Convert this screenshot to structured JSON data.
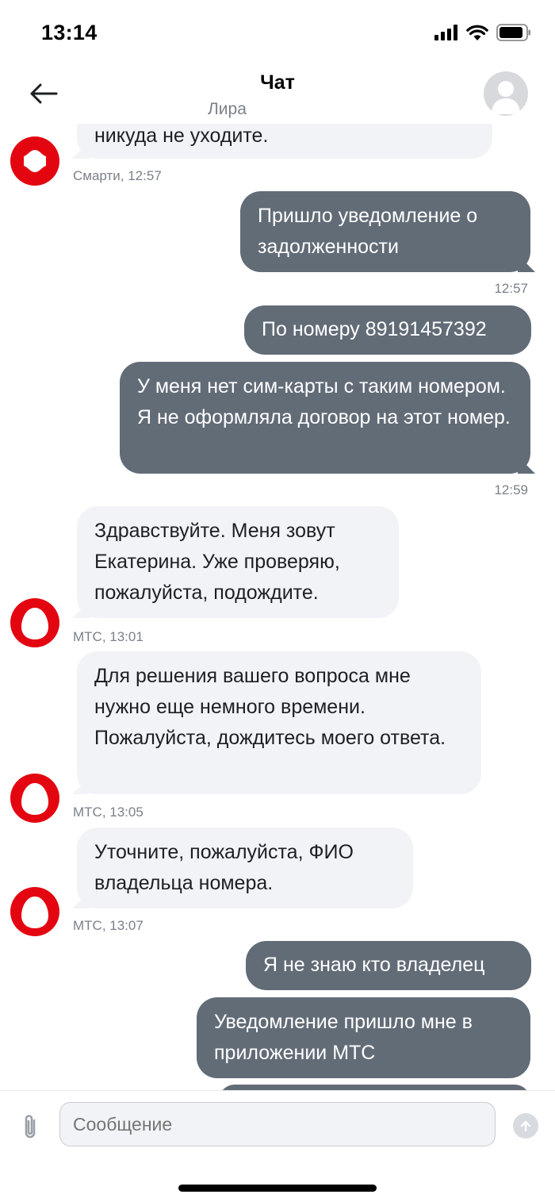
{
  "status_bar": {
    "time": "13:14"
  },
  "header": {
    "title": "Чат",
    "subtitle": "Лира"
  },
  "messages": [
    {
      "text": "никуда не уходите."
    },
    {
      "meta": "Смарти, 12:57"
    },
    {
      "text": "Пришло уведомление о задолженности"
    },
    {
      "meta": "12:57"
    },
    {
      "text": "По номеру 89191457392"
    },
    {
      "text": "У меня нет сим-карты с таким номером. Я не оформляла договор на этот номер."
    },
    {
      "meta": "12:59"
    },
    {
      "text": "Здравствуйте. Меня зовут Екатерина. Уже проверяю, пожалуйста, подождите."
    },
    {
      "meta": "МТС, 13:01"
    },
    {
      "text": "Для решения вашего вопроса мне нужно еще немного времени. Пожалуйста, дождитесь моего ответа."
    },
    {
      "meta": "МТС, 13:05"
    },
    {
      "text": "Уточните, пожалуйста, ФИО владельца номера."
    },
    {
      "meta": "МТС, 13:07"
    },
    {
      "text": "Я не знаю кто владелец"
    },
    {
      "text": "Уведомление пришло мне в приложении МТС"
    }
  ],
  "composer": {
    "placeholder": "Сообщение"
  },
  "icons": {
    "back": "arrow-left-icon",
    "avatar": "user-avatar-icon",
    "smarti": "smarti-logo-icon",
    "mts": "mts-egg-logo-icon",
    "attach": "paperclip-icon",
    "send": "arrow-up-icon"
  },
  "colors": {
    "outgoing_bubble": "#626c77",
    "incoming_bubble": "#f2f3f7",
    "brand_red": "#e30611"
  }
}
